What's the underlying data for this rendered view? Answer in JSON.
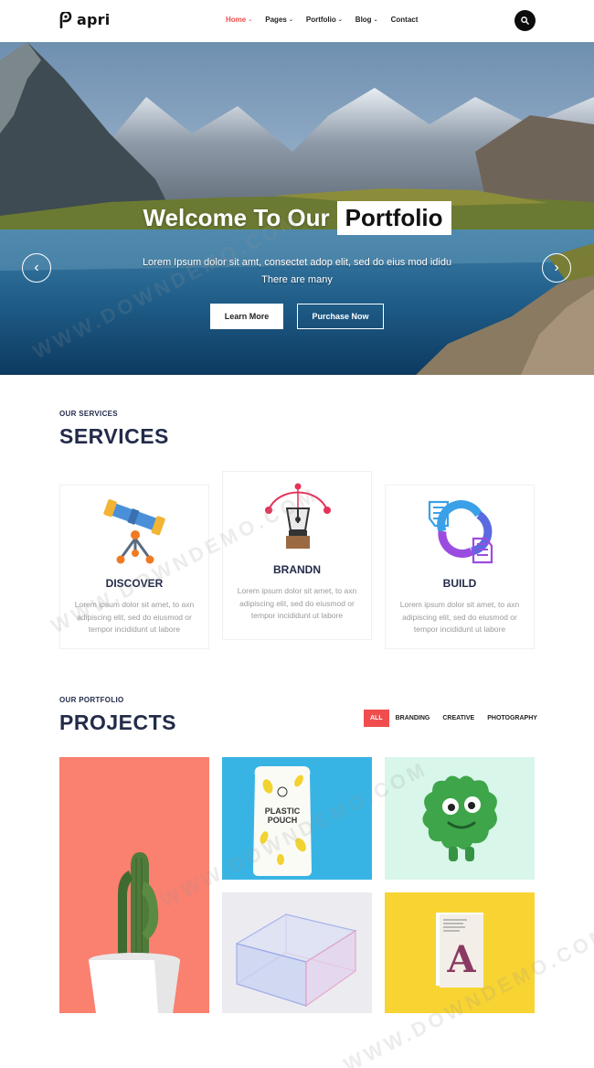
{
  "nav": {
    "logo_text": "apri",
    "items": [
      {
        "label": "Home",
        "caret": true,
        "active": true
      },
      {
        "label": "Pages",
        "caret": true
      },
      {
        "label": "Portfolio",
        "caret": true
      },
      {
        "label": "Blog",
        "caret": true
      },
      {
        "label": "Contact",
        "caret": false
      }
    ],
    "search_icon": "search-icon"
  },
  "hero": {
    "title_part1": "Welcome To Our",
    "title_part2": "Portfolio",
    "text": "Lorem Ipsum dolor sit amt, consectet adop elit, sed do eius mod ididu There are many",
    "learn_more": "Learn More",
    "purchase_now": "Purchase Now",
    "prev_icon": "chevron-left-icon",
    "next_icon": "chevron-right-icon"
  },
  "services": {
    "eyebrow": "OUR SERVICES",
    "title": "SERVICES",
    "cards": [
      {
        "title": "DISCOVER",
        "icon": "telescope-icon",
        "text": "Lorem ipsum dolor sit amet, to axn adipiscing elit, sed do eiusmod or tempor incididunt ut labore"
      },
      {
        "title": "BRANDN",
        "icon": "pen-tool-icon",
        "text": "Lorem ipsum dolor sit amet, to axn adipiscing elit, sed do eiusmod or tempor incididunt ut labore"
      },
      {
        "title": "BUILD",
        "icon": "hands-puzzle-icon",
        "text": "Lorem ipsum dolor sit amet, to axn adipiscing elit, sed do eiusmod or tempor incididunt ut labore"
      }
    ]
  },
  "projects": {
    "eyebrow": "OUR PORTFOLIO",
    "title": "PROJECTS",
    "filters": [
      {
        "label": "ALL",
        "active": true
      },
      {
        "label": "BRANDING"
      },
      {
        "label": "CREATIVE"
      },
      {
        "label": "PHOTOGRAPHY"
      }
    ],
    "tiles": [
      {
        "name": "cactus",
        "bg": "#fa8070"
      },
      {
        "name": "plastic-pouch",
        "bg": "#38b4e4",
        "pouch_line1": "PLASTIC",
        "pouch_line2": "POUCH"
      },
      {
        "name": "green-monster",
        "bg": "#d8f6ea"
      },
      {
        "name": "glass-box",
        "bg": "#ececf0"
      },
      {
        "name": "book-a",
        "bg": "#f8d432",
        "book_letter": "A"
      }
    ]
  },
  "watermark": "WWW.DOWNDEMO.COM",
  "colors": {
    "accent": "#f04e4e",
    "navy": "#232b49",
    "muted": "#9a9a9a"
  }
}
